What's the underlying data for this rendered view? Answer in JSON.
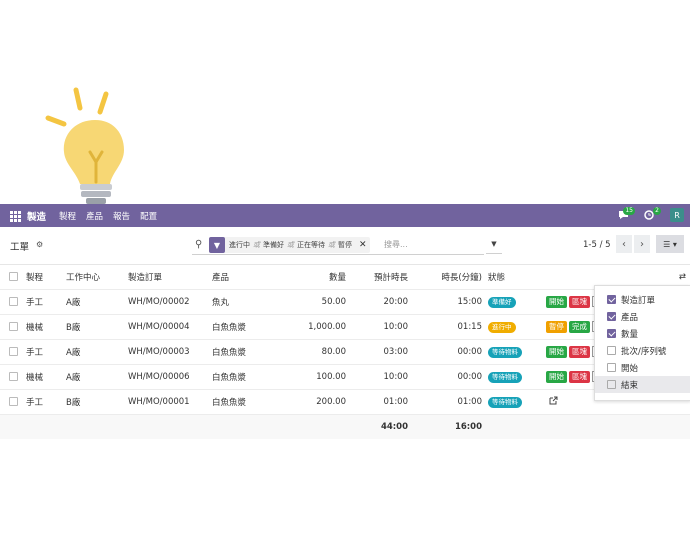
{
  "nav": {
    "brand": "製造",
    "menu": [
      "製程",
      "產品",
      "報告",
      "配置"
    ],
    "chat_count": "15",
    "activity_count": "2",
    "avatar": "R"
  },
  "cp": {
    "title": "工單",
    "filter": {
      "values": [
        "進行中",
        "準備好",
        "正在等待",
        "暫停"
      ],
      "separator": "或"
    },
    "search_placeholder": "搜尋...",
    "pager": "1-5 / 5"
  },
  "table": {
    "headers": {
      "process": "製程",
      "work_center": "工作中心",
      "mo": "製造訂單",
      "product": "產品",
      "quantity": "數量",
      "expected": "預計時長",
      "duration": "時長(分鐘)",
      "status": "狀態"
    },
    "rows": [
      {
        "process": "手工",
        "work_center": "A廠",
        "mo": "WH/MO/00002",
        "product": "魚丸",
        "quantity": "50.00",
        "expected": "20:00",
        "duration": "15:00",
        "status": "準備好",
        "status_color": "#17a2b8",
        "actions": [
          {
            "label": "開始",
            "color": "#28a745"
          },
          {
            "label": "區塊",
            "color": "#dc3545"
          }
        ]
      },
      {
        "process": "機械",
        "work_center": "B廠",
        "mo": "WH/MO/00004",
        "product": "白魚魚漿",
        "quantity": "1,000.00",
        "expected": "10:00",
        "duration": "01:15",
        "status": "進行中",
        "status_color": "#f0ad00",
        "actions": [
          {
            "label": "暫停",
            "color": "#f0a000"
          },
          {
            "label": "完成",
            "color": "#28a745"
          }
        ]
      },
      {
        "process": "手工",
        "work_center": "A廠",
        "mo": "WH/MO/00003",
        "product": "白魚魚漿",
        "quantity": "80.00",
        "expected": "03:00",
        "duration": "00:00",
        "status": "等待物料",
        "status_color": "#17a2b8",
        "actions": [
          {
            "label": "開始",
            "color": "#28a745"
          },
          {
            "label": "區塊",
            "color": "#dc3545"
          }
        ]
      },
      {
        "process": "機械",
        "work_center": "A廠",
        "mo": "WH/MO/00006",
        "product": "白魚魚漿",
        "quantity": "100.00",
        "expected": "10:00",
        "duration": "00:00",
        "status": "等待物料",
        "status_color": "#17a2b8",
        "actions": [
          {
            "label": "開始",
            "color": "#28a745"
          },
          {
            "label": "區塊",
            "color": "#dc3545"
          }
        ]
      },
      {
        "process": "手工",
        "work_center": "B廠",
        "mo": "WH/MO/00001",
        "product": "白魚魚漿",
        "quantity": "200.00",
        "expected": "01:00",
        "duration": "01:00",
        "status": "等待物料",
        "status_color": "#17a2b8",
        "actions": []
      }
    ],
    "totals": {
      "expected": "44:00",
      "duration": "16:00"
    }
  },
  "column_options": [
    {
      "label": "製造訂單",
      "checked": true
    },
    {
      "label": "產品",
      "checked": true
    },
    {
      "label": "數量",
      "checked": true
    },
    {
      "label": "批次/序列號",
      "checked": false
    },
    {
      "label": "開始",
      "checked": false
    },
    {
      "label": "結束",
      "checked": false
    }
  ]
}
